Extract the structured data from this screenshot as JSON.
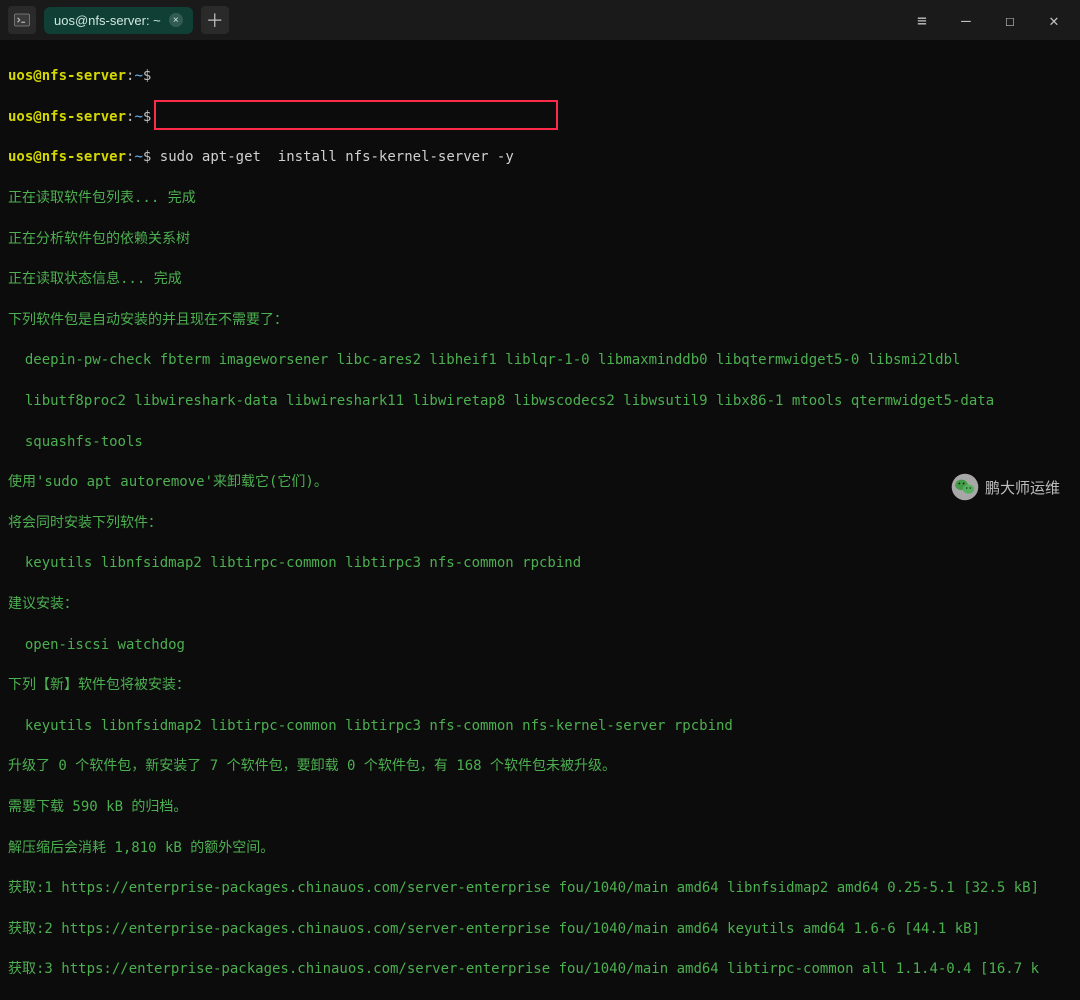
{
  "titlebar": {
    "tab_label": "uos@nfs-server: ~"
  },
  "prompt": {
    "user": "uos",
    "host": "nfs-server",
    "path": "~",
    "dollar": "$"
  },
  "commands": {
    "line1": "",
    "line2": "",
    "line3": "sudo apt-get  install nfs-kernel-server -y"
  },
  "out": {
    "l01": "正在读取软件包列表... 完成",
    "l02": "正在分析软件包的依赖关系树",
    "l03": "正在读取状态信息... 完成",
    "l04": "下列软件包是自动安装的并且现在不需要了：",
    "l05": "deepin-pw-check fbterm imageworsener libc-ares2 libheif1 liblqr-1-0 libmaxminddb0 libqtermwidget5-0 libsmi2ldbl",
    "l06": "libutf8proc2 libwireshark-data libwireshark11 libwiretap8 libwscodecs2 libwsutil9 libx86-1 mtools qtermwidget5-data",
    "l07": "squashfs-tools",
    "l08": "使用'sudo apt autoremove'来卸载它(它们)。",
    "l09": "将会同时安装下列软件：",
    "l10": "keyutils libnfsidmap2 libtirpc-common libtirpc3 nfs-common rpcbind",
    "l11": "建议安装：",
    "l12": "open-iscsi watchdog",
    "l13": "下列【新】软件包将被安装：",
    "l14": "keyutils libnfsidmap2 libtirpc-common libtirpc3 nfs-common nfs-kernel-server rpcbind",
    "l15": "升级了 0 个软件包，新安装了 7 个软件包，要卸载 0 个软件包，有 168 个软件包未被升级。",
    "l16": "需要下载 590 kB 的归档。",
    "l17": "解压缩后会消耗 1,810 kB 的额外空间。",
    "l18": "获取:1 https://enterprise-packages.chinauos.com/server-enterprise fou/1040/main amd64 libnfsidmap2 amd64 0.25-5.1 [32.5 kB]",
    "l19": "获取:2 https://enterprise-packages.chinauos.com/server-enterprise fou/1040/main amd64 keyutils amd64 1.6-6 [44.1 kB]",
    "l20": "获取:3 https://enterprise-packages.chinauos.com/server-enterprise fou/1040/main amd64 libtirpc-common all 1.1.4-0.4 [16.7 k"
  },
  "watermark": {
    "text": "鹏大师运维"
  }
}
